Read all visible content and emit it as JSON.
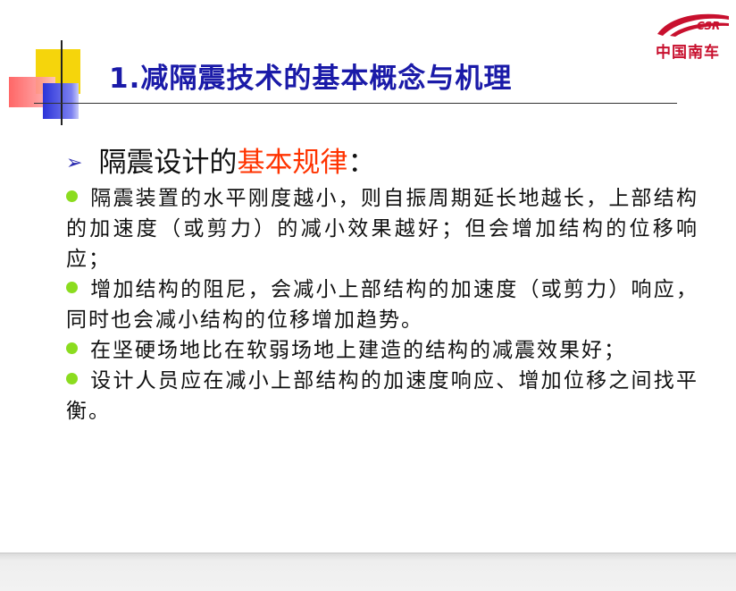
{
  "slide": {
    "title": "1.减隔震技术的基本概念与机理",
    "logo": {
      "mark": "CSR",
      "text": "中国南车"
    },
    "heading": {
      "prefix": "隔震设计的",
      "highlight": "基本规律",
      "suffix": "："
    },
    "bullets": [
      "隔震装置的水平刚度越小，则自振周期延长地越长，上部结构的加速度（或剪力）的减小效果越好；但会增加结构的位移响应；",
      "增加结构的阻尼，会减小上部结构的加速度（或剪力）响应，同时也会减小结构的位移增加趋势。",
      "在坚硬场地比在软弱场地上建造的结构的减震效果好；",
      "设计人员应在减小上部结构的加速度响应、增加位移之间找平衡。"
    ]
  },
  "colors": {
    "title": "#1a1aa8",
    "highlight": "#ff3300",
    "bullet": "#8bdc1f",
    "logo": "#c8102e"
  }
}
